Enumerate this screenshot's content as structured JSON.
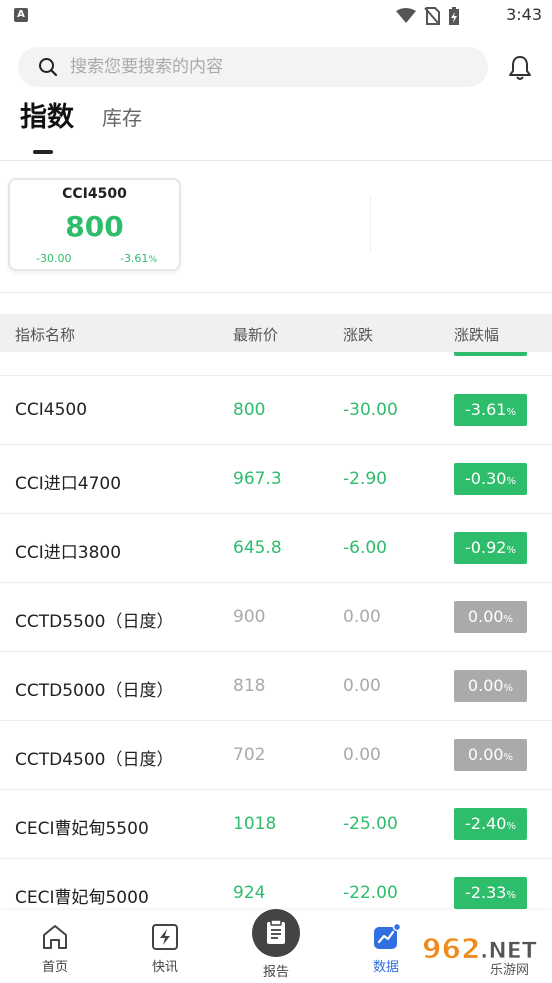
{
  "status_bar": {
    "time": "3:43"
  },
  "search": {
    "placeholder": "搜索您要搜索的内容"
  },
  "tabs": [
    {
      "label": "指数",
      "active": true
    },
    {
      "label": "库存",
      "active": false
    }
  ],
  "index_card": {
    "name": "CCI4500",
    "price": "800",
    "change": "-30.00",
    "percent": "-3.61",
    "percent_unit": "%"
  },
  "table": {
    "headers": [
      "指标名称",
      "最新价",
      "涨跌",
      "涨跌幅"
    ],
    "rows": [
      {
        "name": "CCI4500",
        "price": "800",
        "change": "-30.00",
        "percent": "-3.61",
        "unit": "%",
        "trend": "down"
      },
      {
        "name": "CCI进口4700",
        "price": "967.3",
        "change": "-2.90",
        "percent": "-0.30",
        "unit": "%",
        "trend": "down"
      },
      {
        "name": "CCI进口3800",
        "price": "645.8",
        "change": "-6.00",
        "percent": "-0.92",
        "unit": "%",
        "trend": "down"
      },
      {
        "name": "CCTD5500（日度）",
        "price": "900",
        "change": "0.00",
        "percent": "0.00",
        "unit": "%",
        "trend": "flat"
      },
      {
        "name": "CCTD5000（日度）",
        "price": "818",
        "change": "0.00",
        "percent": "0.00",
        "unit": "%",
        "trend": "flat"
      },
      {
        "name": "CCTD4500（日度）",
        "price": "702",
        "change": "0.00",
        "percent": "0.00",
        "unit": "%",
        "trend": "flat"
      },
      {
        "name": "CECI曹妃甸5500",
        "price": "1018",
        "change": "-25.00",
        "percent": "-2.40",
        "unit": "%",
        "trend": "down"
      },
      {
        "name": "CECI曹妃甸5000",
        "price": "924",
        "change": "-22.00",
        "percent": "-2.33",
        "unit": "%",
        "trend": "down"
      }
    ]
  },
  "bottom_nav": {
    "home": "首页",
    "flash": "快讯",
    "report": "报告",
    "data": "数据"
  },
  "watermark": {
    "text_top": "962",
    "text_net": ".NET",
    "text_bottom": "乐游网"
  },
  "colors": {
    "green": "#2ebd6b",
    "gray": "#aaaaaa",
    "active_blue": "#2f6fe0"
  }
}
